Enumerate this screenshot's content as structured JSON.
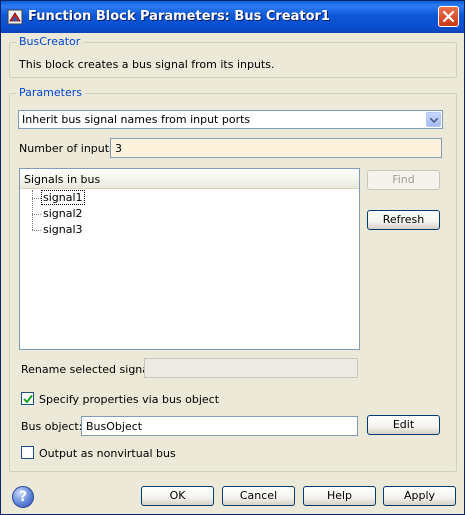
{
  "window": {
    "title": "Function Block Parameters: Bus Creator1"
  },
  "buscreator_group": {
    "legend": "BusCreator",
    "description": "This block creates a bus signal from its inputs."
  },
  "parameters_group": {
    "legend": "Parameters",
    "mode_select": {
      "selected": "Inherit bus signal names from input ports"
    },
    "num_inputs": {
      "label": "Number of inputs:",
      "value": "3"
    },
    "signals_list": {
      "header": "Signals in bus",
      "items": [
        "signal1",
        "signal2",
        "signal3"
      ],
      "selected_index": 0
    },
    "find_label": "Find",
    "refresh_label": "Refresh",
    "rename": {
      "label": "Rename selected signal:",
      "value": ""
    },
    "specify_bus_object": {
      "label": "Specify properties via bus object",
      "checked": true
    },
    "bus_object": {
      "label": "Bus object:",
      "value": "BusObject"
    },
    "edit_label": "Edit",
    "nonvirtual": {
      "label": "Output as nonvirtual bus",
      "checked": false
    }
  },
  "footer": {
    "ok_label": "OK",
    "cancel_label": "Cancel",
    "help_label": "Help",
    "apply_label": "Apply",
    "help_icon_glyph": "?"
  },
  "icons": {
    "app": "simulink-block-icon",
    "close": "close-icon",
    "dropdown": "chevron-down-icon",
    "check": "checkmark-icon",
    "help": "question-mark-icon"
  }
}
